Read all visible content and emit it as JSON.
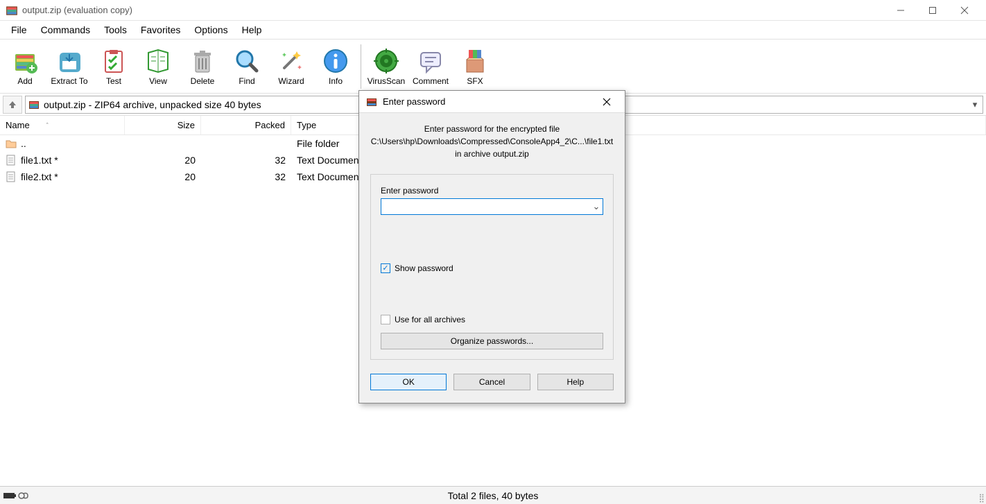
{
  "window": {
    "title": "output.zip (evaluation copy)"
  },
  "menu": {
    "items": [
      "File",
      "Commands",
      "Tools",
      "Favorites",
      "Options",
      "Help"
    ]
  },
  "toolbar": {
    "items": [
      "Add",
      "Extract To",
      "Test",
      "View",
      "Delete",
      "Find",
      "Wizard",
      "Info",
      "VirusScan",
      "Comment",
      "SFX"
    ]
  },
  "addressbar": {
    "path": "output.zip - ZIP64 archive, unpacked size 40 bytes"
  },
  "columns": {
    "name": "Name",
    "size": "Size",
    "packed": "Packed",
    "type": "Type"
  },
  "files": [
    {
      "name": "..",
      "size": "",
      "packed": "",
      "type": "File folder",
      "icon": "folder"
    },
    {
      "name": "file1.txt *",
      "size": "20",
      "packed": "32",
      "type": "Text Document",
      "icon": "file"
    },
    {
      "name": "file2.txt *",
      "size": "20",
      "packed": "32",
      "type": "Text Document",
      "icon": "file"
    }
  ],
  "status": {
    "text": "Total 2 files, 40 bytes"
  },
  "dialog": {
    "title": "Enter password",
    "message_l1": "Enter password for the encrypted file",
    "message_l2": "C:\\Users\\hp\\Downloads\\Compressed\\ConsoleApp4_2\\C...\\file1.txt",
    "message_l3": "in archive output.zip",
    "field_label": "Enter password",
    "password_value": "",
    "show_password_label": "Show password",
    "show_password_checked": true,
    "use_all_label": "Use for all archives",
    "use_all_checked": false,
    "organize_label": "Organize passwords...",
    "ok_label": "OK",
    "cancel_label": "Cancel",
    "help_label": "Help"
  }
}
